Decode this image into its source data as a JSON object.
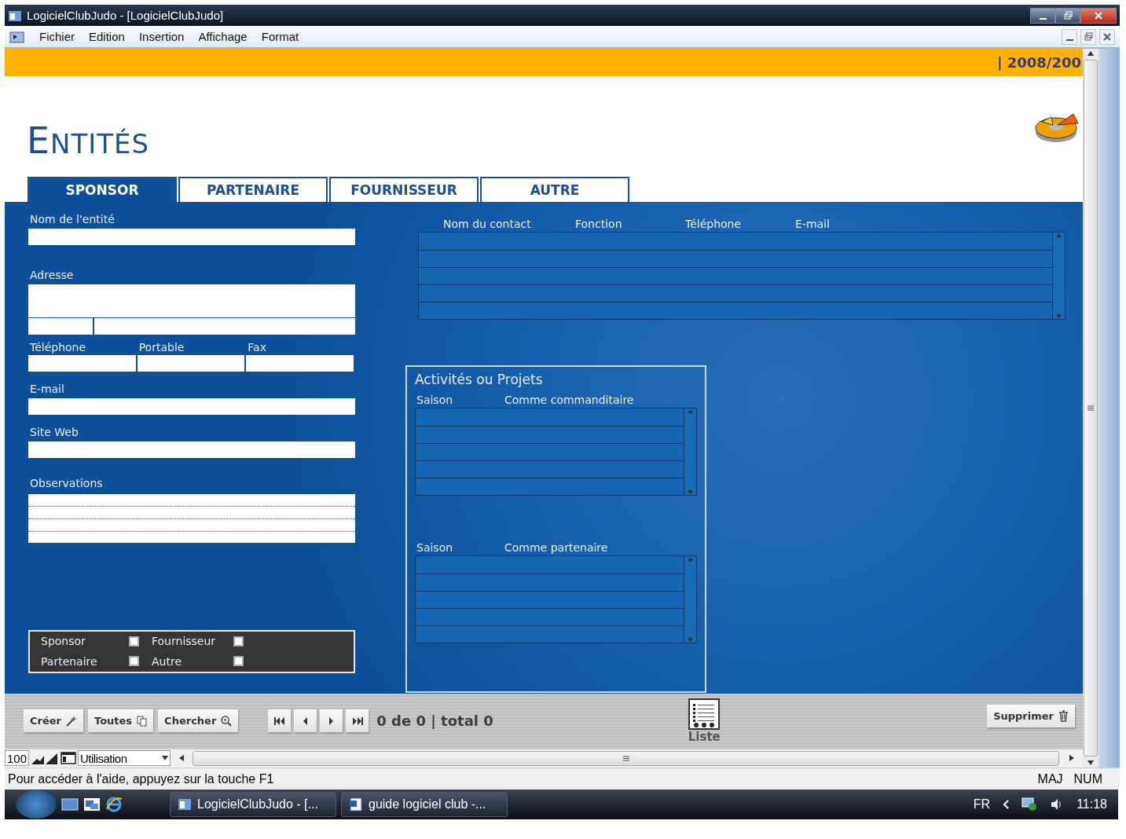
{
  "window": {
    "title": "LogicielClubJudo - [LogicielClubJudo]"
  },
  "menu": [
    "Fichier",
    "Edition",
    "Insertion",
    "Affichage",
    "Format"
  ],
  "header": {
    "season": "| 2008/200",
    "title": "ENTITÉS"
  },
  "tabs": [
    {
      "label": "SPONSOR",
      "selected": true
    },
    {
      "label": "PARTENAIRE",
      "selected": false
    },
    {
      "label": "FOURNISSEUR",
      "selected": false
    },
    {
      "label": "AUTRE",
      "selected": false
    }
  ],
  "form": {
    "name_label": "Nom de l'entité",
    "address_label": "Adresse",
    "phone_labels": [
      "Téléphone",
      "Portable",
      "Fax"
    ],
    "email_label": "E-mail",
    "web_label": "Site Web",
    "notes_label": "Observations"
  },
  "types": [
    {
      "label": "Sponsor",
      "checked": false
    },
    {
      "label": "Fournisseur",
      "checked": false
    },
    {
      "label": "Partenaire",
      "checked": false
    },
    {
      "label": "Autre",
      "checked": false
    }
  ],
  "contacts": {
    "columns": [
      "Nom du contact",
      "Fonction",
      "Téléphone",
      "E-mail"
    ]
  },
  "activities": {
    "title": "Activités ou Projets",
    "tables": [
      {
        "columns": [
          "Saison",
          "Comme commanditaire"
        ]
      },
      {
        "columns": [
          "Saison",
          "Comme partenaire"
        ]
      }
    ]
  },
  "toolbar": {
    "buttons": [
      "Créer",
      "Toutes",
      "Chercher"
    ],
    "record_count": "0 de 0 | total 0",
    "list_label": "Liste",
    "delete_label": "Supprimer"
  },
  "view_bar": {
    "zoom": "100",
    "view": "Utilisation"
  },
  "status_bar": {
    "message": "Pour accéder à l'aide, appuyez sur la touche F1",
    "indicators": [
      "MAJ",
      "NUM"
    ]
  },
  "taskbar": {
    "tasks": [
      "LogicielClubJudo - [...",
      "guide logiciel club -..."
    ],
    "language": "FR",
    "clock": "11:18"
  }
}
